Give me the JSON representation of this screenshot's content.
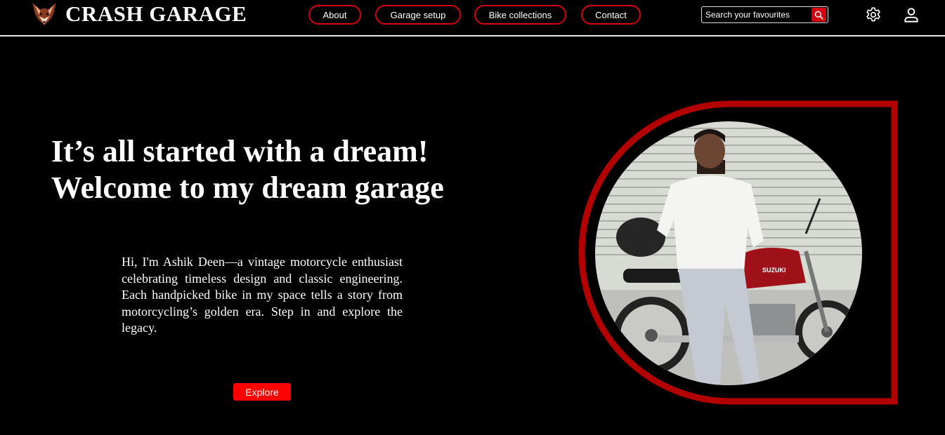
{
  "header": {
    "brand": "CRASH GARAGE",
    "logo_icon": "fox-head-icon",
    "nav": [
      "About",
      "Garage setup",
      "Bike collections",
      "Contact"
    ],
    "search": {
      "placeholder": "Search your favourites",
      "button_icon": "search-icon"
    },
    "settings_icon": "gear-icon",
    "profile_icon": "user-icon"
  },
  "hero": {
    "title_line1": "It’s all started with a dream!",
    "title_line2": "Welcome to my dream garage",
    "intro": "Hi, I'm Ashik Deen—a vintage motorcycle enthusiast celebrating timeless design and classic engineering. Each handpicked bike in my space tells a story from motorcycling’s golden era. Step in and explore the legacy.",
    "cta_label": "Explore",
    "photo_bike_label": "SUZUKI"
  },
  "colors": {
    "background": "#000000",
    "accent": "#d40010",
    "frame": "#b30000",
    "cta": "#ff0000",
    "text": "#ffffff"
  }
}
